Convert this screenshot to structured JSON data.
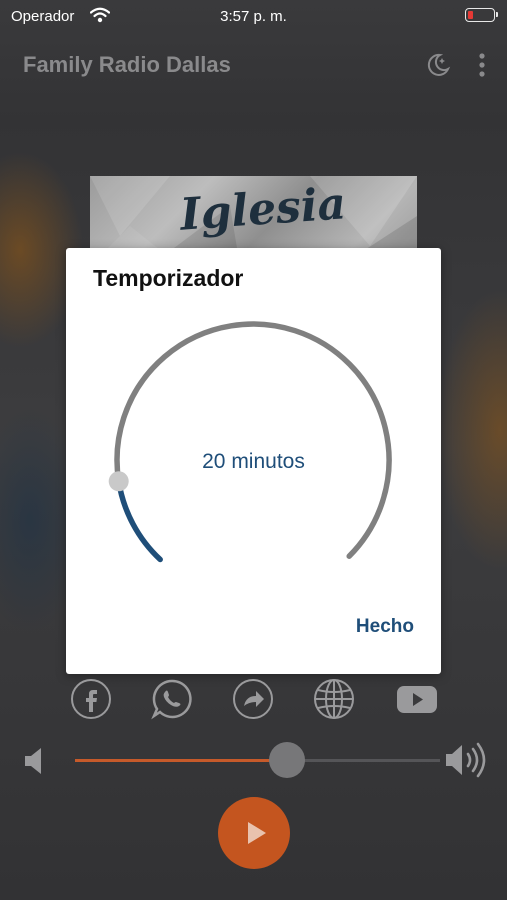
{
  "status_bar": {
    "carrier": "Operador",
    "time": "3:57 p. m.",
    "battery_color": "#e53935"
  },
  "header": {
    "title": "Family Radio Dallas"
  },
  "artwork": {
    "text": "Iglesia"
  },
  "timer_dialog": {
    "title": "Temporizador",
    "value_label": "20 minutos",
    "done_label": "Hecho",
    "accent_color": "#1f4e79"
  },
  "share_buttons": [
    "facebook-icon",
    "whatsapp-icon",
    "share-icon",
    "globe-icon",
    "youtube-icon"
  ],
  "volume": {
    "level": 0.58,
    "accent_color": "#c65a2a"
  },
  "player": {
    "button_color": "#c4551f"
  }
}
